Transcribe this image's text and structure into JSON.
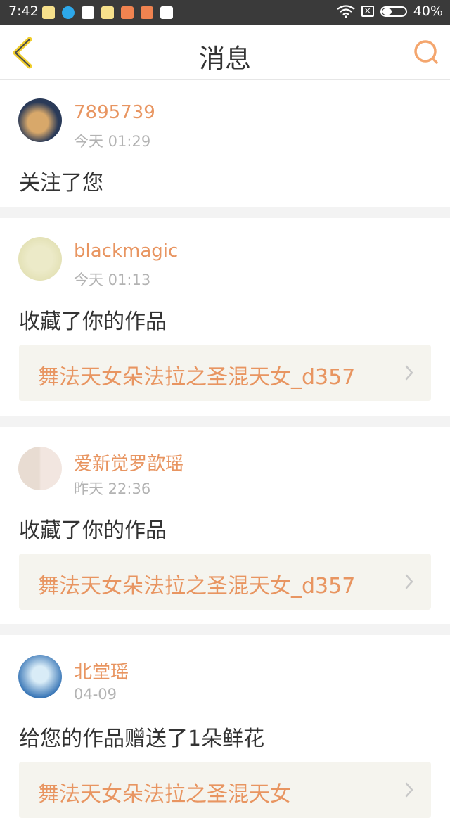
{
  "status_bar": {
    "time": "7:42",
    "battery": "40%",
    "battery_level": 0.4,
    "app_icons": [
      "emoji-face-icon",
      "blue-circle-icon",
      "play-store-icon",
      "emoji-face-icon",
      "mail-icon",
      "mail-icon",
      "play-store-icon"
    ]
  },
  "nav": {
    "title": "消息",
    "back_icon": "chevron-left-icon",
    "search_icon": "search-icon"
  },
  "colors": {
    "accent": "#e89561",
    "back_icon": "#f1cf2e",
    "search_icon": "#f4a66e",
    "card_bg": "#f5f4ee",
    "separator": "#f3f3f3"
  },
  "messages": [
    {
      "user": "7895739",
      "time": "今天 01:29",
      "action": "关注了您"
    },
    {
      "user": "blackmagic",
      "time": "今天 01:13",
      "action": "收藏了你的作品",
      "work": "舞法天女朵法拉之圣混天女_d357"
    },
    {
      "user": "爱新觉罗歆瑶",
      "time": "昨天 22:36",
      "action": "收藏了你的作品",
      "work": "舞法天女朵法拉之圣混天女_d357"
    },
    {
      "user": "北堂瑶",
      "time": "04-09",
      "action": "给您的作品赠送了1朵鲜花",
      "work": "舞法天女朵法拉之圣混天女"
    }
  ]
}
